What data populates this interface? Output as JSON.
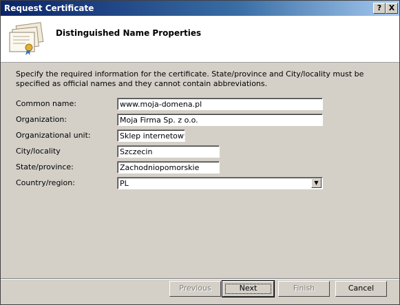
{
  "window": {
    "title": "Request Certificate",
    "help_button": "?",
    "close_button": "X"
  },
  "header": {
    "title": "Distinguished Name Properties",
    "icon": "certificate-icon"
  },
  "description": "Specify the required information for the certificate. State/province and City/locality must be specified as official names and they cannot contain abbreviations.",
  "form": {
    "common_name": {
      "label": "Common name:",
      "value": "www.moja-domena.pl"
    },
    "organization": {
      "label": "Organization:",
      "value": "Moja Firma Sp. z o.o."
    },
    "organizational_unit": {
      "label": "Organizational unit:",
      "value": "Sklep internetowy"
    },
    "city": {
      "label": "City/locality",
      "value": "Szczecin"
    },
    "state": {
      "label": "State/province:",
      "value": "Zachodniopomorskie"
    },
    "country": {
      "label": "Country/region:",
      "value": "PL"
    }
  },
  "buttons": {
    "previous": "Previous",
    "next": "Next",
    "finish": "Finish",
    "cancel": "Cancel"
  }
}
